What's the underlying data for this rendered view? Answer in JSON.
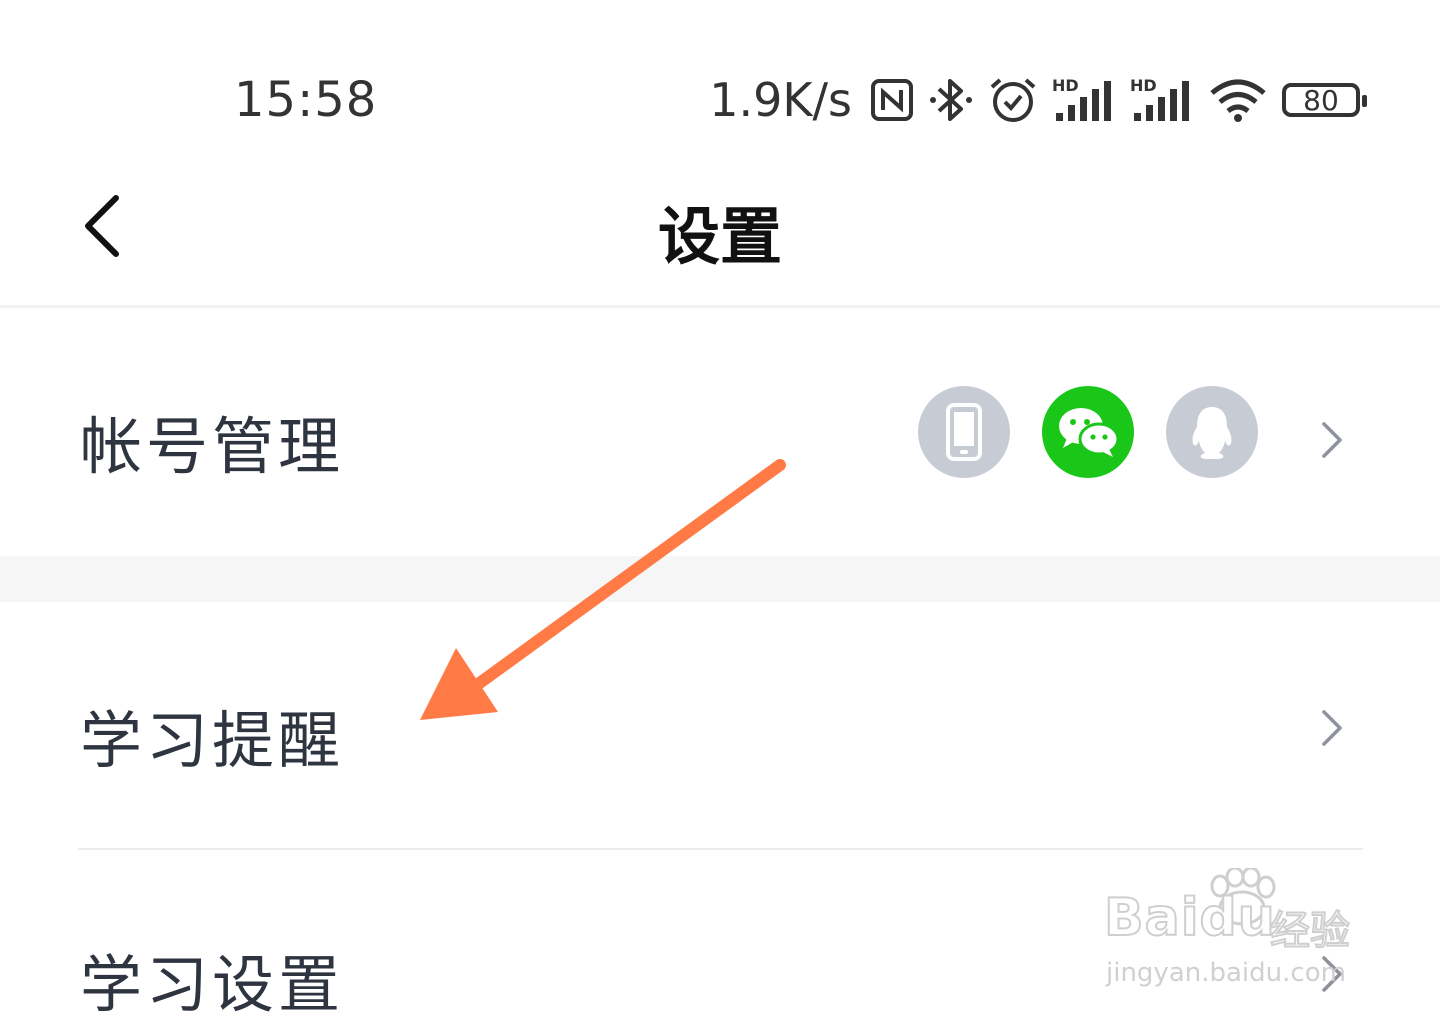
{
  "status_bar": {
    "time": "15:58",
    "net_speed": "1.9K/s",
    "icons": [
      "nfc-icon",
      "bluetooth-icon",
      "alarm-icon",
      "signal-hd-icon",
      "signal-hd-icon",
      "wifi-icon"
    ],
    "hd_label": "HD",
    "battery": "80"
  },
  "nav": {
    "title": "设置",
    "back_icon": "chevron-left-icon"
  },
  "rows": [
    {
      "label": "帐号管理",
      "linked_accounts": [
        {
          "name": "phone-icon",
          "color": "#c7ccd4"
        },
        {
          "name": "wechat-icon",
          "color": "#1ac718"
        },
        {
          "name": "qq-icon",
          "color": "#c7ccd4"
        }
      ]
    },
    {
      "label": "学习提醒"
    },
    {
      "label": "学习设置"
    }
  ],
  "annotation": {
    "arrow_color": "#ff7a45"
  },
  "watermark": {
    "brand": "Baidu",
    "product": "经验",
    "url": "jingyan.baidu.com"
  }
}
